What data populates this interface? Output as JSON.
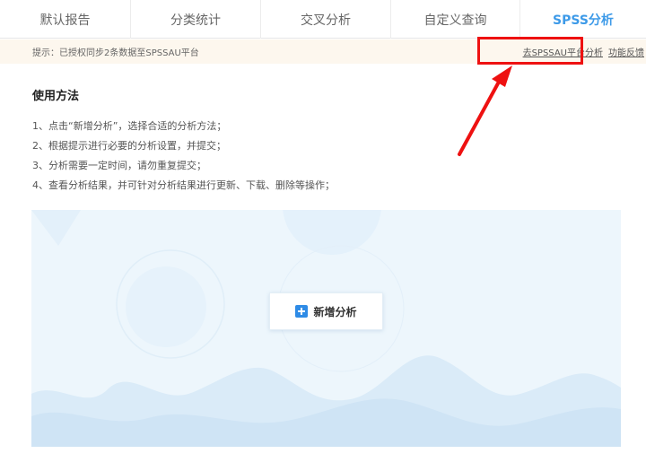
{
  "tabs": [
    {
      "label": "默认报告"
    },
    {
      "label": "分类统计"
    },
    {
      "label": "交叉分析"
    },
    {
      "label": "自定义查询"
    },
    {
      "label": "SPSS分析"
    }
  ],
  "active_tab": "SPSS分析",
  "notice": {
    "text": "提示：已授权同步2条数据至SPSSAU平台",
    "platform_link": "去SPSSAU平台分析",
    "feedback_link": "功能反馈"
  },
  "usage": {
    "title": "使用方法",
    "steps": [
      "1、点击“新增分析”，选择合适的分析方法；",
      "2、根据提示进行必要的分析设置，并提交；",
      "3、分析需要一定时间，请勿重复提交；",
      "4、查看分析结果，并可针对分析结果进行更新、下载、删除等操作；"
    ]
  },
  "panel": {
    "add_label": "新增分析"
  },
  "colors": {
    "accent": "#3d9ae8",
    "notice_bg": "#fdf7ee",
    "highlight": "#ee1111",
    "panel_bg": "#edf6fc"
  },
  "icons": [
    "plus-icon",
    "red-arrow-annotation"
  ]
}
